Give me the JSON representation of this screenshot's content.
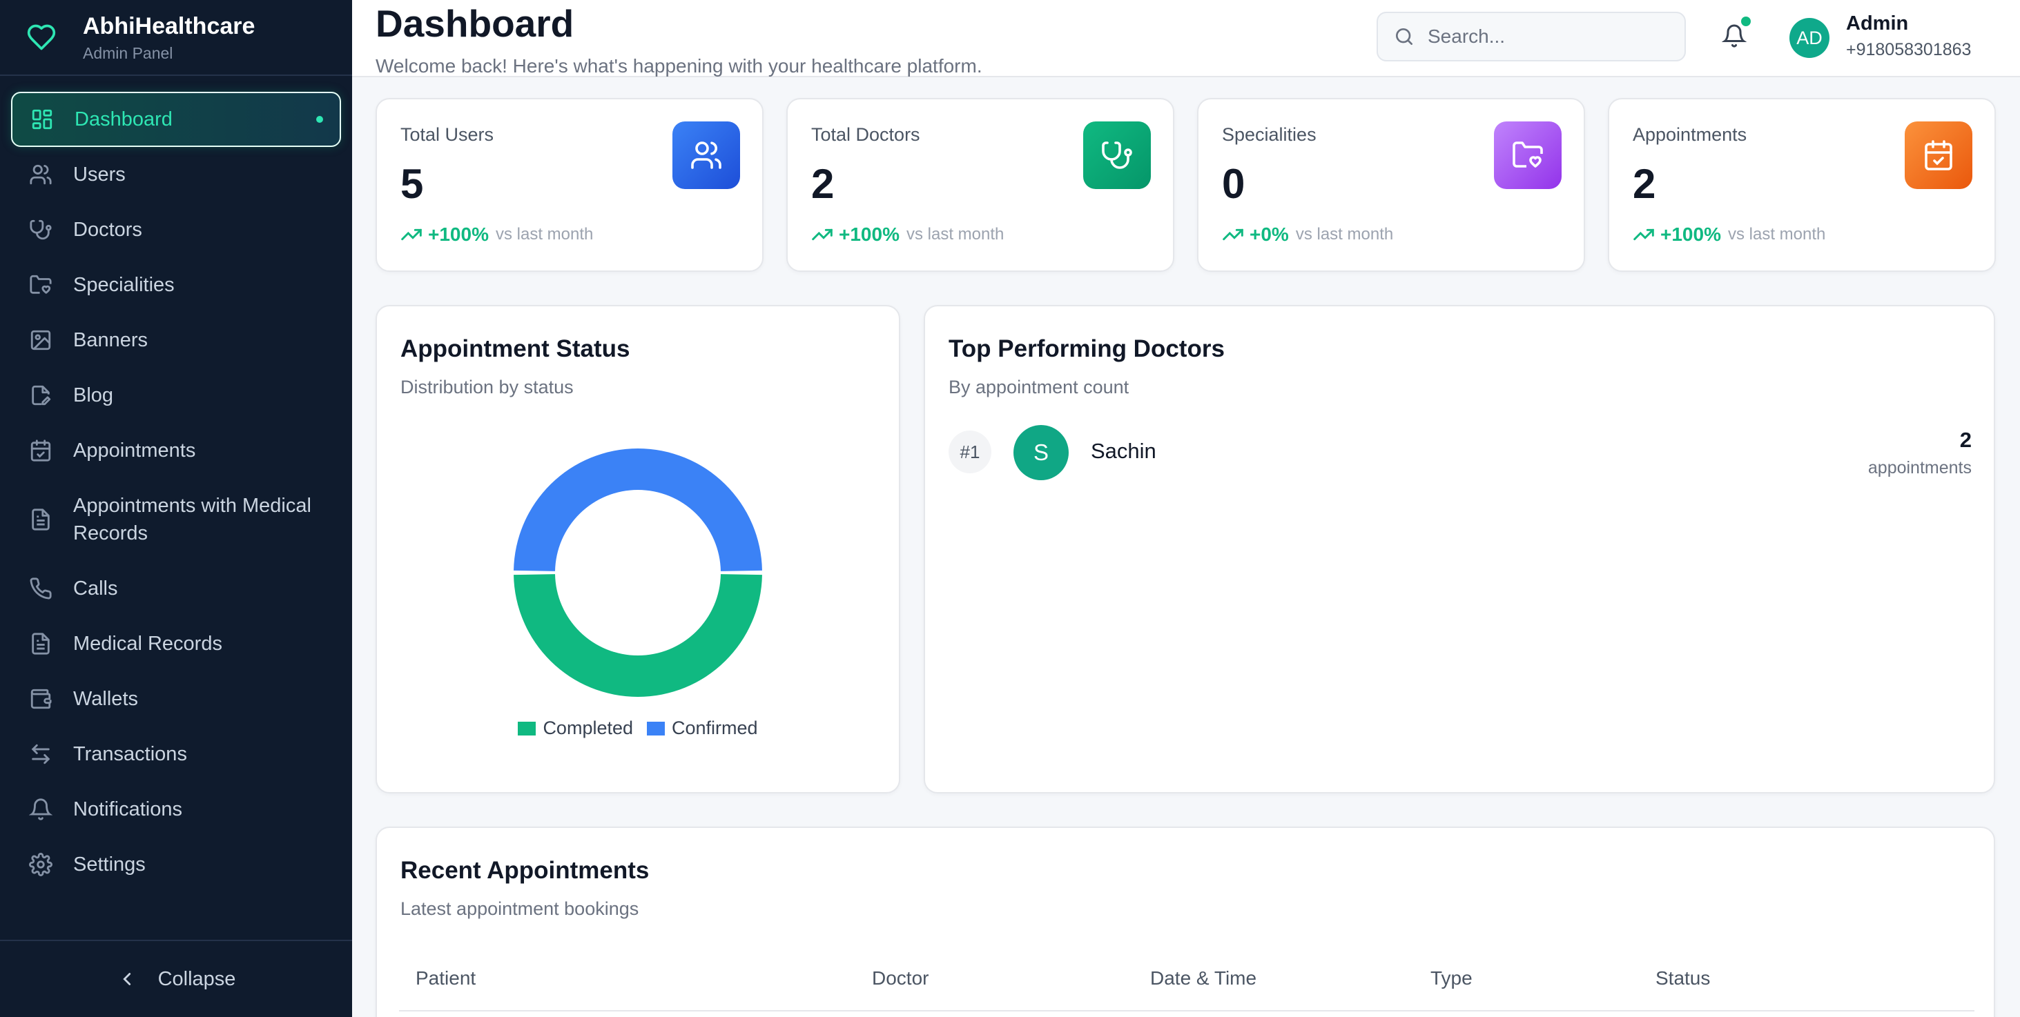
{
  "brand": {
    "title": "AbhiHealthcare",
    "subtitle": "Admin Panel"
  },
  "sidebar": {
    "items": [
      {
        "label": "Dashboard",
        "icon": "grid-icon",
        "active": true
      },
      {
        "label": "Users",
        "icon": "users-icon"
      },
      {
        "label": "Doctors",
        "icon": "stethoscope-icon"
      },
      {
        "label": "Specialities",
        "icon": "folder-heart-icon"
      },
      {
        "label": "Banners",
        "icon": "image-icon"
      },
      {
        "label": "Blog",
        "icon": "edit-file-icon"
      },
      {
        "label": "Appointments",
        "icon": "calendar-check-icon"
      },
      {
        "label": "Appointments with Medical Records",
        "icon": "file-text-icon"
      },
      {
        "label": "Calls",
        "icon": "phone-icon"
      },
      {
        "label": "Medical Records",
        "icon": "file-text-icon"
      },
      {
        "label": "Wallets",
        "icon": "wallet-icon"
      },
      {
        "label": "Transactions",
        "icon": "arrows-left-right-icon"
      },
      {
        "label": "Notifications",
        "icon": "bell-icon"
      },
      {
        "label": "Settings",
        "icon": "gear-icon"
      }
    ],
    "collapse_label": "Collapse"
  },
  "header": {
    "title": "Dashboard",
    "subtitle": "Welcome back! Here's what's happening with your healthcare platform.",
    "search_placeholder": "Search...",
    "avatar_initials": "AD",
    "admin_name": "Admin",
    "admin_phone": "+918058301863"
  },
  "stats": [
    {
      "label": "Total Users",
      "value": "5",
      "trend": "+100%",
      "trend_text": "vs last month",
      "color": "#2563eb",
      "icon": "users-icon"
    },
    {
      "label": "Total Doctors",
      "value": "2",
      "trend": "+100%",
      "trend_text": "vs last month",
      "color": "#10b981",
      "icon": "stethoscope-icon"
    },
    {
      "label": "Specialities",
      "value": "0",
      "trend": "+0%",
      "trend_text": "vs last month",
      "color": "#a855f7",
      "icon": "folder-heart-icon"
    },
    {
      "label": "Appointments",
      "value": "2",
      "trend": "+100%",
      "trend_text": "vs last month",
      "color": "#f97316",
      "icon": "calendar-check-icon"
    }
  ],
  "appointment_status": {
    "title": "Appointment Status",
    "subtitle": "Distribution by status"
  },
  "chart_data": {
    "type": "pie",
    "categories": [
      "Completed",
      "Confirmed"
    ],
    "values": [
      1,
      1
    ],
    "colors": [
      "#10b981",
      "#3b82f6"
    ],
    "legend": "bottom"
  },
  "top_doctors": {
    "title": "Top Performing Doctors",
    "subtitle": "By appointment count",
    "items": [
      {
        "rank": "#1",
        "initial": "S",
        "name": "Sachin",
        "count": "2",
        "count_label": "appointments"
      }
    ]
  },
  "recent": {
    "title": "Recent Appointments",
    "subtitle": "Latest appointment bookings",
    "columns": [
      "Patient",
      "Doctor",
      "Date & Time",
      "Type",
      "Status"
    ]
  }
}
